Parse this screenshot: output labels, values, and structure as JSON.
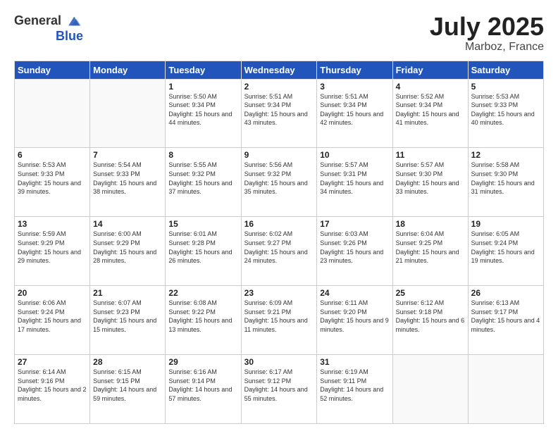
{
  "header": {
    "logo_general": "General",
    "logo_blue": "Blue",
    "month_title": "July 2025",
    "location": "Marboz, France"
  },
  "days_of_week": [
    "Sunday",
    "Monday",
    "Tuesday",
    "Wednesday",
    "Thursday",
    "Friday",
    "Saturday"
  ],
  "weeks": [
    [
      {
        "day": "",
        "info": ""
      },
      {
        "day": "",
        "info": ""
      },
      {
        "day": "1",
        "info": "Sunrise: 5:50 AM\nSunset: 9:34 PM\nDaylight: 15 hours and 44 minutes."
      },
      {
        "day": "2",
        "info": "Sunrise: 5:51 AM\nSunset: 9:34 PM\nDaylight: 15 hours and 43 minutes."
      },
      {
        "day": "3",
        "info": "Sunrise: 5:51 AM\nSunset: 9:34 PM\nDaylight: 15 hours and 42 minutes."
      },
      {
        "day": "4",
        "info": "Sunrise: 5:52 AM\nSunset: 9:34 PM\nDaylight: 15 hours and 41 minutes."
      },
      {
        "day": "5",
        "info": "Sunrise: 5:53 AM\nSunset: 9:33 PM\nDaylight: 15 hours and 40 minutes."
      }
    ],
    [
      {
        "day": "6",
        "info": "Sunrise: 5:53 AM\nSunset: 9:33 PM\nDaylight: 15 hours and 39 minutes."
      },
      {
        "day": "7",
        "info": "Sunrise: 5:54 AM\nSunset: 9:33 PM\nDaylight: 15 hours and 38 minutes."
      },
      {
        "day": "8",
        "info": "Sunrise: 5:55 AM\nSunset: 9:32 PM\nDaylight: 15 hours and 37 minutes."
      },
      {
        "day": "9",
        "info": "Sunrise: 5:56 AM\nSunset: 9:32 PM\nDaylight: 15 hours and 35 minutes."
      },
      {
        "day": "10",
        "info": "Sunrise: 5:57 AM\nSunset: 9:31 PM\nDaylight: 15 hours and 34 minutes."
      },
      {
        "day": "11",
        "info": "Sunrise: 5:57 AM\nSunset: 9:30 PM\nDaylight: 15 hours and 33 minutes."
      },
      {
        "day": "12",
        "info": "Sunrise: 5:58 AM\nSunset: 9:30 PM\nDaylight: 15 hours and 31 minutes."
      }
    ],
    [
      {
        "day": "13",
        "info": "Sunrise: 5:59 AM\nSunset: 9:29 PM\nDaylight: 15 hours and 29 minutes."
      },
      {
        "day": "14",
        "info": "Sunrise: 6:00 AM\nSunset: 9:29 PM\nDaylight: 15 hours and 28 minutes."
      },
      {
        "day": "15",
        "info": "Sunrise: 6:01 AM\nSunset: 9:28 PM\nDaylight: 15 hours and 26 minutes."
      },
      {
        "day": "16",
        "info": "Sunrise: 6:02 AM\nSunset: 9:27 PM\nDaylight: 15 hours and 24 minutes."
      },
      {
        "day": "17",
        "info": "Sunrise: 6:03 AM\nSunset: 9:26 PM\nDaylight: 15 hours and 23 minutes."
      },
      {
        "day": "18",
        "info": "Sunrise: 6:04 AM\nSunset: 9:25 PM\nDaylight: 15 hours and 21 minutes."
      },
      {
        "day": "19",
        "info": "Sunrise: 6:05 AM\nSunset: 9:24 PM\nDaylight: 15 hours and 19 minutes."
      }
    ],
    [
      {
        "day": "20",
        "info": "Sunrise: 6:06 AM\nSunset: 9:24 PM\nDaylight: 15 hours and 17 minutes."
      },
      {
        "day": "21",
        "info": "Sunrise: 6:07 AM\nSunset: 9:23 PM\nDaylight: 15 hours and 15 minutes."
      },
      {
        "day": "22",
        "info": "Sunrise: 6:08 AM\nSunset: 9:22 PM\nDaylight: 15 hours and 13 minutes."
      },
      {
        "day": "23",
        "info": "Sunrise: 6:09 AM\nSunset: 9:21 PM\nDaylight: 15 hours and 11 minutes."
      },
      {
        "day": "24",
        "info": "Sunrise: 6:11 AM\nSunset: 9:20 PM\nDaylight: 15 hours and 9 minutes."
      },
      {
        "day": "25",
        "info": "Sunrise: 6:12 AM\nSunset: 9:18 PM\nDaylight: 15 hours and 6 minutes."
      },
      {
        "day": "26",
        "info": "Sunrise: 6:13 AM\nSunset: 9:17 PM\nDaylight: 15 hours and 4 minutes."
      }
    ],
    [
      {
        "day": "27",
        "info": "Sunrise: 6:14 AM\nSunset: 9:16 PM\nDaylight: 15 hours and 2 minutes."
      },
      {
        "day": "28",
        "info": "Sunrise: 6:15 AM\nSunset: 9:15 PM\nDaylight: 14 hours and 59 minutes."
      },
      {
        "day": "29",
        "info": "Sunrise: 6:16 AM\nSunset: 9:14 PM\nDaylight: 14 hours and 57 minutes."
      },
      {
        "day": "30",
        "info": "Sunrise: 6:17 AM\nSunset: 9:12 PM\nDaylight: 14 hours and 55 minutes."
      },
      {
        "day": "31",
        "info": "Sunrise: 6:19 AM\nSunset: 9:11 PM\nDaylight: 14 hours and 52 minutes."
      },
      {
        "day": "",
        "info": ""
      },
      {
        "day": "",
        "info": ""
      }
    ]
  ]
}
